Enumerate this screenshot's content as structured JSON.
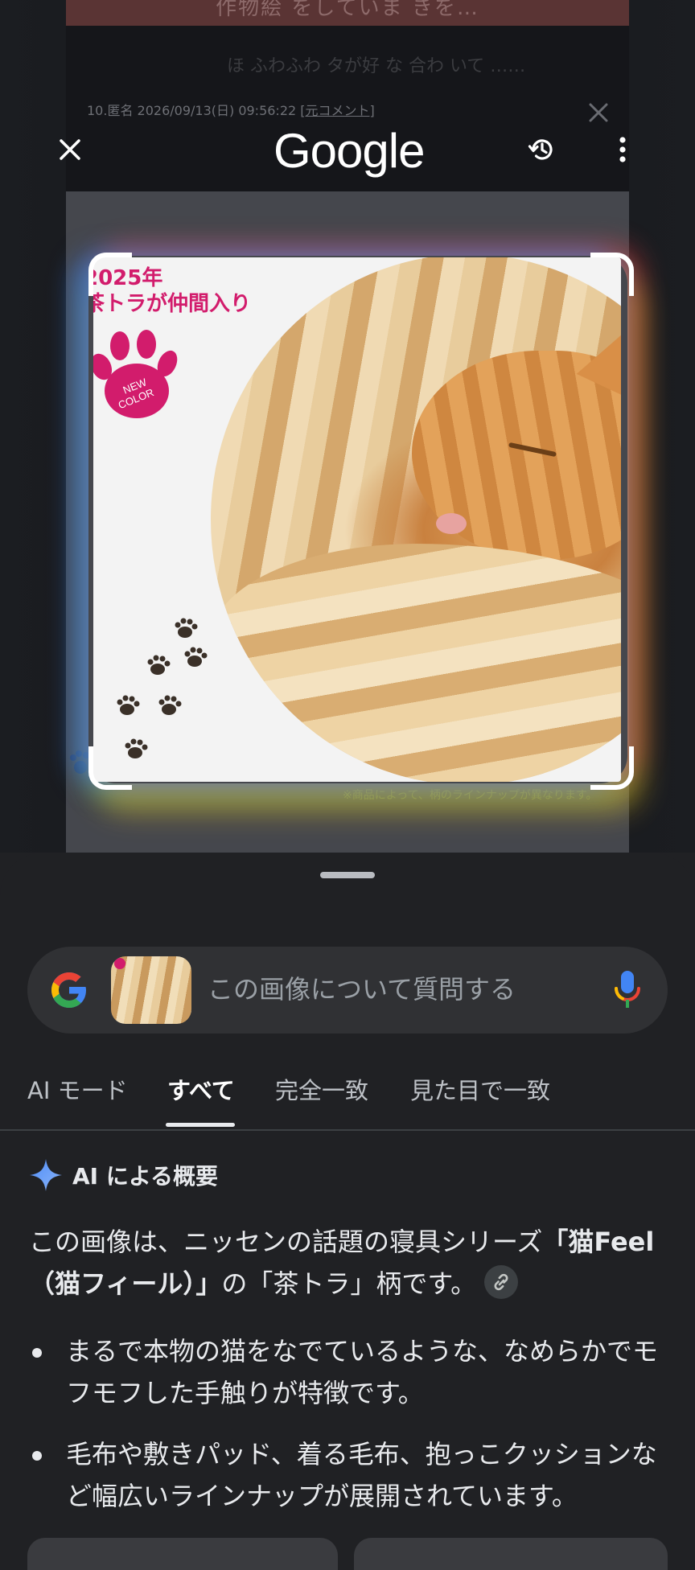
{
  "background_page": {
    "banner_text": "作物絵 をしていま  きを…",
    "comment_text": "ほ  ふわふわ  タが好 な  合わ  いて  ……",
    "meta_text": "10.匿名 2026/09/13(日) 09:56:22",
    "meta_link": "[元コメント]",
    "product_note": "※商品によって、柄のラインナップが異なります。"
  },
  "toolbar": {
    "close_icon": "close-icon",
    "logo_text": "Google",
    "history_icon": "history-icon",
    "more_icon": "more-vert-icon"
  },
  "selected_image": {
    "badge_title_line1": "2025年",
    "badge_title_line2": "茶トラが仲間入り",
    "badge_stamp": "NEW COLOR",
    "accent_color": "#d21c6c"
  },
  "search": {
    "placeholder": "この画像について質問する",
    "mic_icon": "mic-icon"
  },
  "tabs": [
    {
      "label": "AI モード"
    },
    {
      "label": "すべて",
      "active": true
    },
    {
      "label": "完全一致"
    },
    {
      "label": "見た目で一致"
    }
  ],
  "ai_overview": {
    "heading": "AI による概要",
    "summary_prefix": "この画像は、ニッセンの話題の寝具シリーズ",
    "summary_bold": "「猫Feel（猫フィール）」",
    "summary_suffix": "の「茶トラ」柄です。",
    "bullets": [
      "まるで本物の猫をなでているような、なめらかでモフモフした手触りが特徴です。",
      "毛布や敷きパッド、着る毛布、抱っこクッションなど幅広いラインナップが展開されています。"
    ]
  },
  "colors": {
    "sheet_bg": "#202124",
    "search_bg": "#303134",
    "text_primary": "#e8eaed",
    "text_secondary": "#9aa0a6"
  }
}
